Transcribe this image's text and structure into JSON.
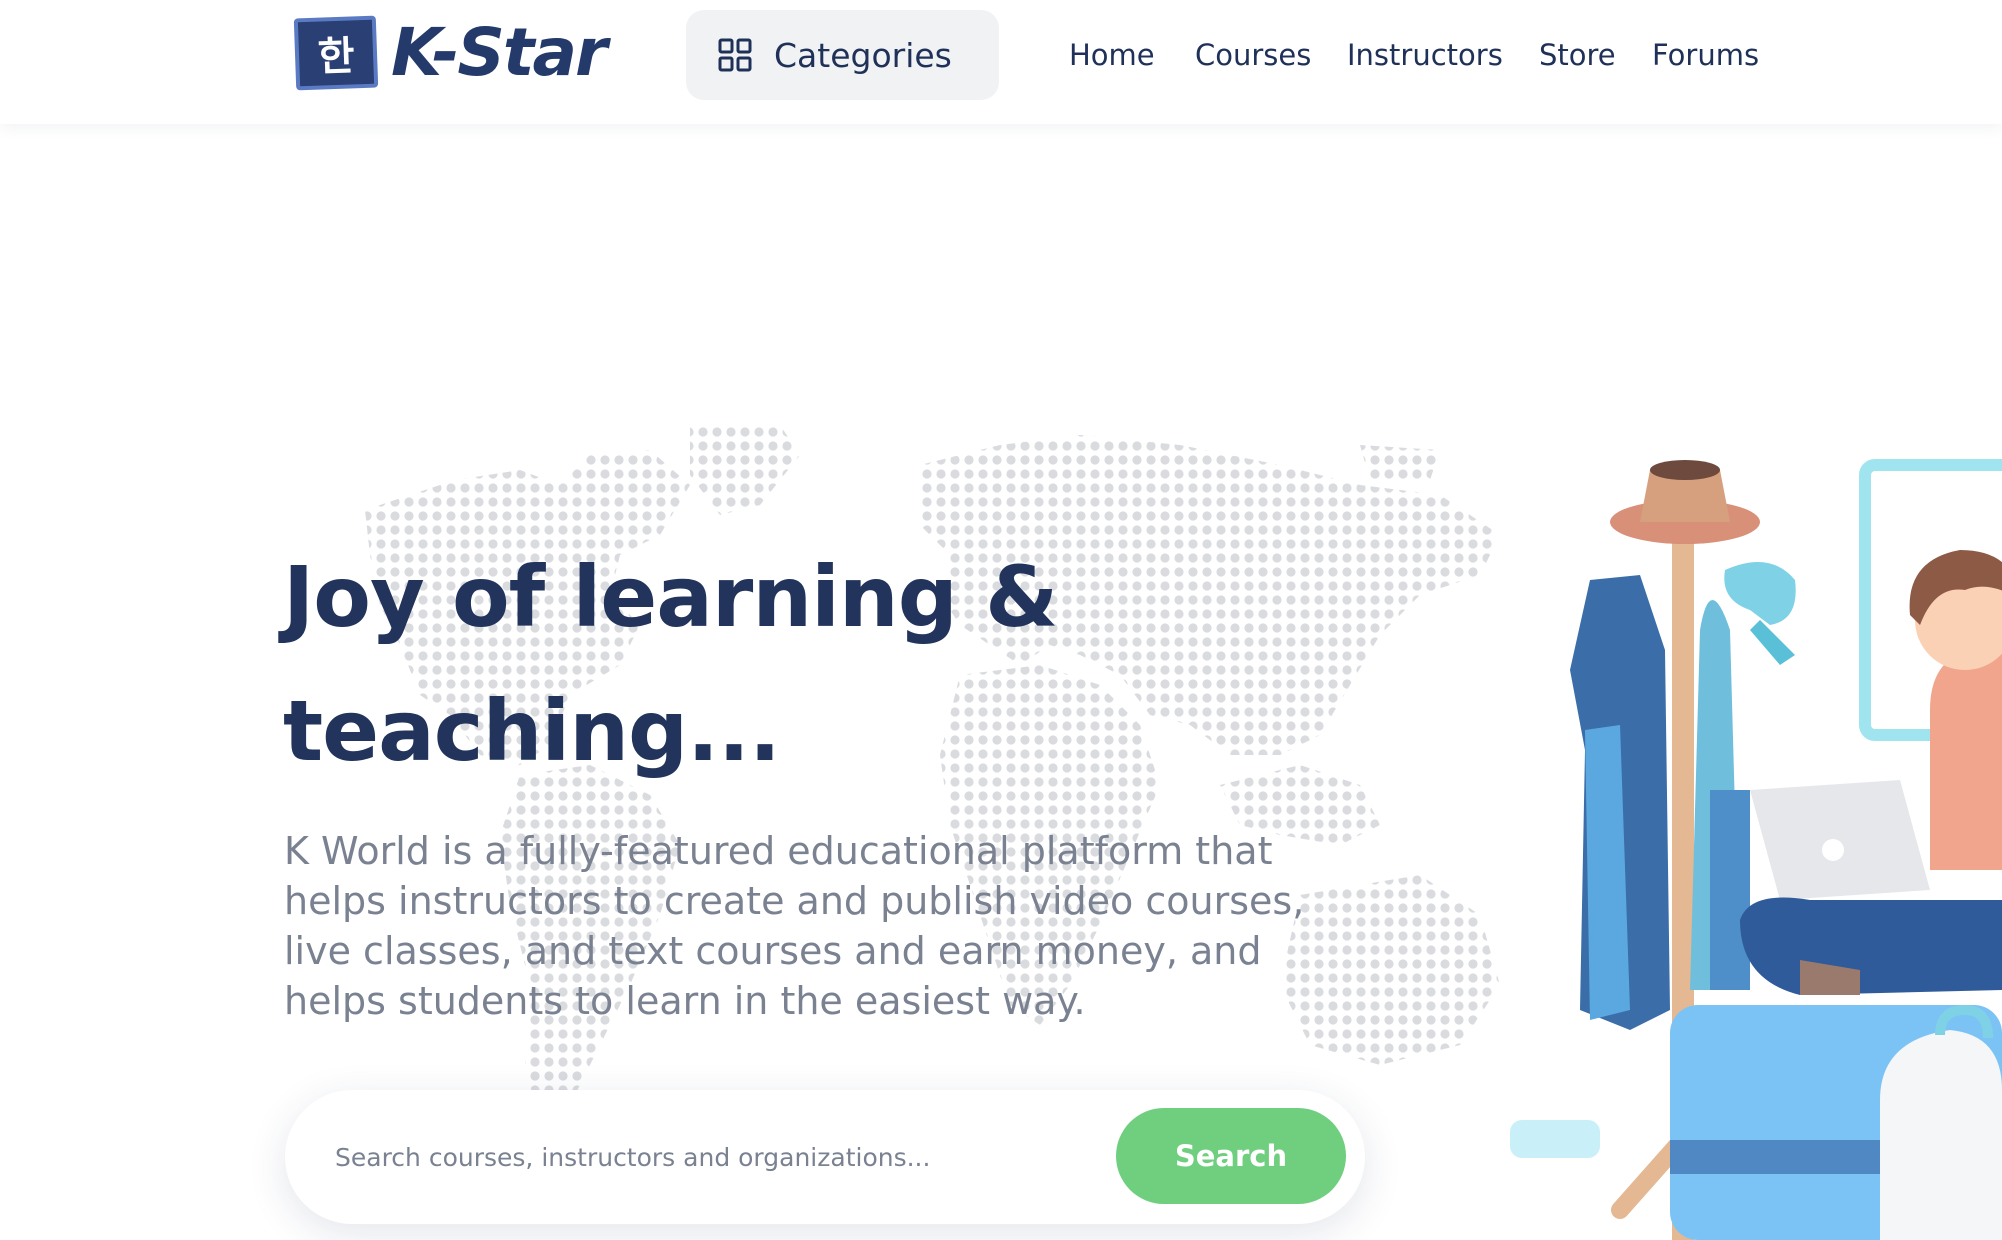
{
  "header": {
    "logo_text": "K-Star",
    "logo_badge_glyph": "한",
    "categories_label": "Categories",
    "categories_icon": "grid-icon",
    "nav": [
      {
        "label": "Home"
      },
      {
        "label": "Courses"
      },
      {
        "label": "Instructors"
      },
      {
        "label": "Store"
      },
      {
        "label": "Forums"
      }
    ]
  },
  "hero": {
    "title_line1": "Joy of learning &",
    "title_line2": "teaching...",
    "description": "K World is a fully-featured educational platform that helps instructors to create and publish video courses, live classes, and text courses and earn money, and helps students to learn in the easiest way."
  },
  "search": {
    "placeholder": "Search courses, instructors and organizations...",
    "value": "",
    "button_label": "Search"
  },
  "colors": {
    "brand_navy": "#22335c",
    "text_muted": "#7a8292",
    "search_button": "#6fcf7f",
    "categories_bg": "#f1f2f4",
    "map_dots": "#d6d8dc"
  }
}
